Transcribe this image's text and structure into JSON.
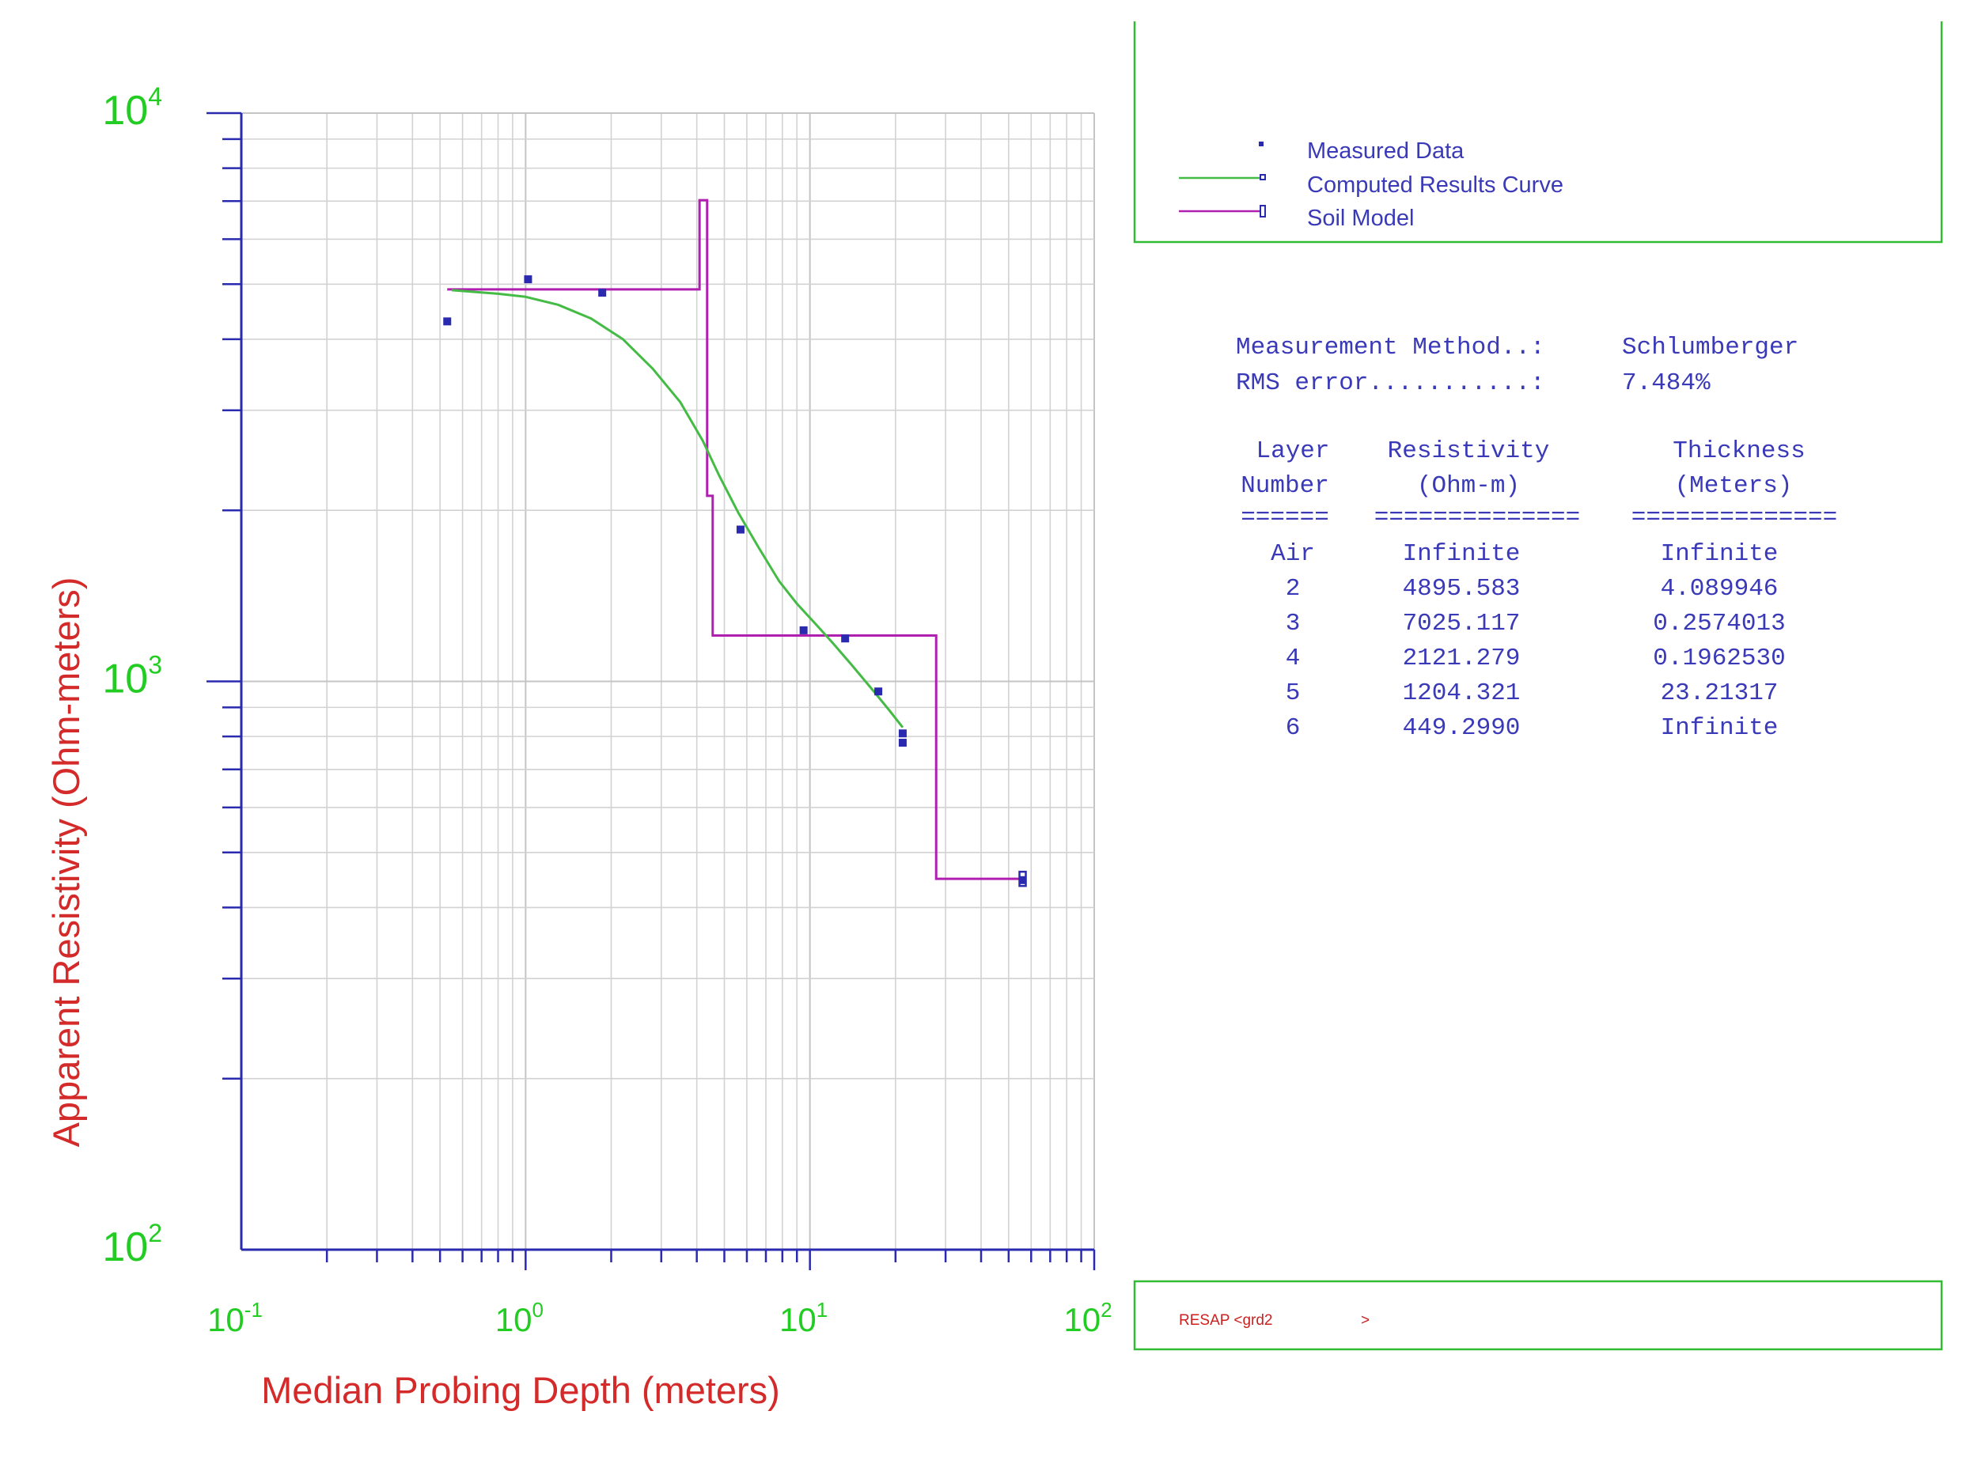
{
  "colors": {
    "axis": "#2a2ab0",
    "tick_label": "#22cc22",
    "axis_title": "#d42a2a",
    "measured": "#2a2ab0",
    "computed": "#44bb44",
    "soil_model": "#b020b0",
    "panel_border": "#33bb33",
    "report_text": "#3a3ab8",
    "status_text": "#cc2020"
  },
  "chart_data": {
    "type": "scatter",
    "xscale": "log",
    "yscale": "log",
    "xlim": [
      0.1,
      100
    ],
    "ylim": [
      100,
      10000
    ],
    "xlabel": "Median Probing Depth (meters)",
    "ylabel": "Apparent Resistivity (Ohm-meters)",
    "x_ticks": [
      {
        "value": 0.1,
        "base": "10",
        "exp": "-1"
      },
      {
        "value": 1,
        "base": "10",
        "exp": "0"
      },
      {
        "value": 10,
        "base": "10",
        "exp": "1"
      },
      {
        "value": 100,
        "base": "10",
        "exp": "2"
      }
    ],
    "y_ticks": [
      {
        "value": 100,
        "base": "10",
        "exp": "2"
      },
      {
        "value": 1000,
        "base": "10",
        "exp": "3"
      },
      {
        "value": 10000,
        "base": "10",
        "exp": "4"
      }
    ],
    "grid": true,
    "legend_position": "top-right panel",
    "series": [
      {
        "name": "Measured Data",
        "kind": "points",
        "points": [
          [
            0.53,
            4300
          ],
          [
            1.02,
            5100
          ],
          [
            1.86,
            4830
          ],
          [
            5.7,
            1850
          ],
          [
            9.5,
            1230
          ],
          [
            13.3,
            1190
          ],
          [
            17.4,
            960
          ],
          [
            21.2,
            810
          ],
          [
            21.2,
            780
          ],
          [
            56,
            447
          ]
        ]
      },
      {
        "name": "Computed Results Curve",
        "kind": "line",
        "points": [
          [
            0.55,
            4880
          ],
          [
            0.8,
            4810
          ],
          [
            1.0,
            4750
          ],
          [
            1.3,
            4600
          ],
          [
            1.7,
            4350
          ],
          [
            2.2,
            4000
          ],
          [
            2.8,
            3550
          ],
          [
            3.5,
            3100
          ],
          [
            4.2,
            2650
          ],
          [
            4.8,
            2300
          ],
          [
            5.6,
            1980
          ],
          [
            6.6,
            1720
          ],
          [
            7.8,
            1500
          ],
          [
            9.0,
            1370
          ],
          [
            10.5,
            1260
          ],
          [
            12.0,
            1170
          ],
          [
            14.0,
            1070
          ],
          [
            16.5,
            970
          ],
          [
            19.0,
            890
          ],
          [
            21.2,
            830
          ]
        ]
      },
      {
        "name": "Soil Model",
        "kind": "step",
        "points": [
          [
            0.53,
            4895.583
          ],
          [
            4.09,
            4895.583
          ],
          [
            4.09,
            7025.117
          ],
          [
            4.35,
            7025.117
          ],
          [
            4.35,
            2121.279
          ],
          [
            4.55,
            2121.279
          ],
          [
            4.55,
            1204.321
          ],
          [
            27.8,
            1204.321
          ],
          [
            27.8,
            449.299
          ],
          [
            56,
            449.299
          ]
        ]
      }
    ]
  },
  "legend": {
    "items": [
      {
        "label": "Measured Data"
      },
      {
        "label": "Computed Results Curve"
      },
      {
        "label": "Soil Model"
      }
    ]
  },
  "report": {
    "method_label": "Measurement Method..:",
    "method_value": "Schlumberger",
    "rms_label": "RMS error...........:",
    "rms_value": "7.484%",
    "headers": {
      "layer_1": "Layer",
      "layer_2": "Number",
      "resistivity_1": "Resistivity",
      "resistivity_2": "(Ohm-m)",
      "thickness_1": "Thickness",
      "thickness_2": "(Meters)",
      "rule_layer": "======",
      "rule_resistivity": "==============",
      "rule_thickness": "=============="
    },
    "rows": [
      {
        "layer": "Air",
        "resistivity": "Infinite",
        "thickness": "Infinite"
      },
      {
        "layer": "2",
        "resistivity": "4895.583",
        "thickness": "4.089946"
      },
      {
        "layer": "3",
        "resistivity": "7025.117",
        "thickness": "0.2574013"
      },
      {
        "layer": "4",
        "resistivity": "2121.279",
        "thickness": "0.1962530"
      },
      {
        "layer": "5",
        "resistivity": "1204.321",
        "thickness": "23.21317"
      },
      {
        "layer": "6",
        "resistivity": "449.2990",
        "thickness": "Infinite"
      }
    ]
  },
  "status": {
    "text": "RESAP <grd2",
    "suffix": ">"
  }
}
